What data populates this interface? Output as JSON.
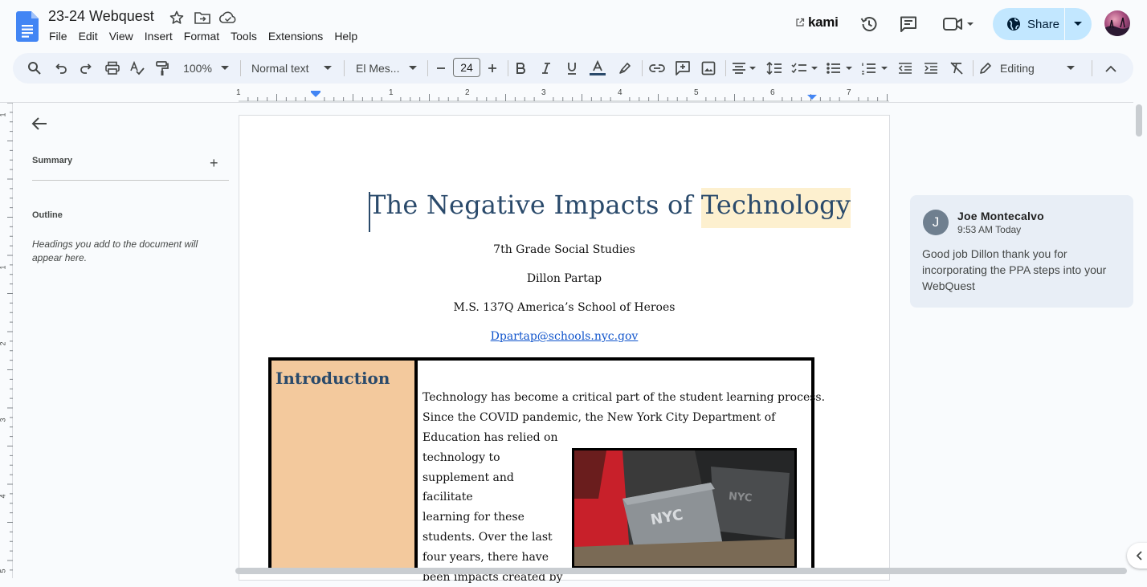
{
  "app": {
    "doc_title": "23-24 Webquest",
    "menu": [
      "File",
      "Edit",
      "View",
      "Insert",
      "Format",
      "Tools",
      "Extensions",
      "Help"
    ],
    "kami_label": "kami",
    "share_label": "Share"
  },
  "toolbar": {
    "zoom": "100%",
    "style": "Normal text",
    "font": "El Mes...",
    "font_size": "24",
    "mode": "Editing"
  },
  "ruler": {
    "h_ticks": [
      "1",
      "1",
      "2",
      "3",
      "4",
      "5",
      "6",
      "7"
    ],
    "v_ticks": [
      "1",
      "1",
      "2",
      "3",
      "4",
      "5"
    ]
  },
  "outline": {
    "summary_label": "Summary",
    "summary_add": "+",
    "outline_label": "Outline",
    "empty_text": "Headings you add to the document will appear here."
  },
  "document": {
    "heading_main": "The Negative Impacts of ",
    "heading_highlight": "Technology",
    "subtitle": "7th Grade Social Studies",
    "author": "Dillon Partap",
    "school": "M.S. 137Q America’s School of Heroes",
    "email": "Dpartap@schools.nyc.gov",
    "table_heading": "Introduction",
    "para_line1": "Technology has become a critical part of the student learning process.",
    "para_line2": "Since the COVID pandemic, the New York City Department of",
    "para_narrow": [
      "Education has relied on",
      "technology to",
      "supplement and facilitate",
      "learning for these",
      "students. Over the last",
      "four years, there have",
      "been impacts created by"
    ],
    "photo_text": "NYC"
  },
  "comment": {
    "avatar_letter": "J",
    "author": "Joe Montecalvo",
    "time": "9:53 AM Today",
    "body": "Good job Dillon thank you for incorporating the PPA steps into your WebQuest"
  },
  "colors": {
    "share_bg": "#c2e7ff",
    "heading": "#2a4a6b",
    "highlight": "#fdf0cf",
    "table_cell": "#f3c99d",
    "link": "#1155cc"
  }
}
